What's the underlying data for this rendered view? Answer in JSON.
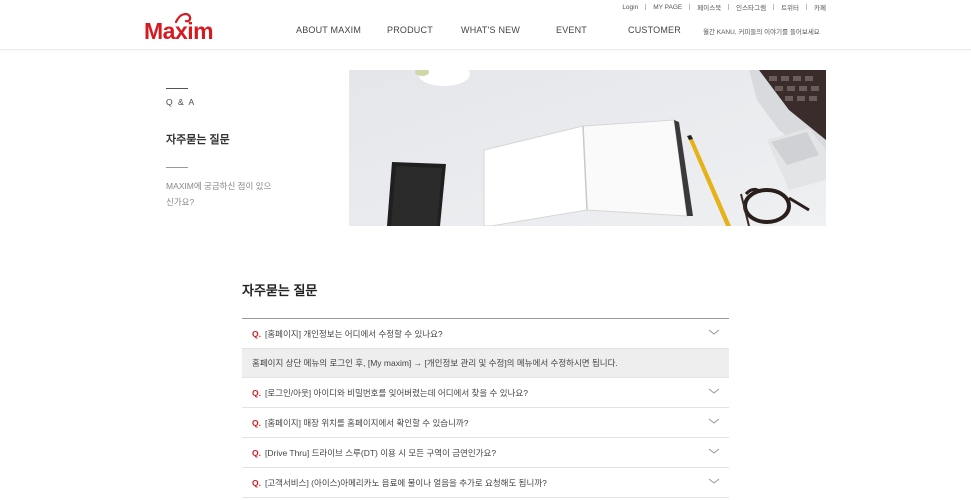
{
  "brand": {
    "logo_text": "Maxim",
    "color": "#d71920"
  },
  "util_links": [
    "Login",
    "MY PAGE",
    "페이스북",
    "인스타그램",
    "트위터",
    "카페"
  ],
  "gnb": {
    "items": [
      "ABOUT MAXIM",
      "PRODUCT",
      "WHAT'S NEW",
      "EVENT",
      "CUSTOMER"
    ],
    "note": "월간 KANU, 커피들의 이야기를 들어보세요"
  },
  "sidebar": {
    "category": "Q & A",
    "title": "자주묻는 질문",
    "description": "MAXIM에 궁금하신 점이 있으신가요?"
  },
  "faq": {
    "heading": "자주묻는 질문",
    "q_prefix": "Q.",
    "items": [
      {
        "question": "[홈페이지] 개인정보는 어디에서 수정할 수 있나요?",
        "expanded": true,
        "answer": "홈페이지 상단 메뉴의 로그인 후, [My maxim] → [개인정보 관리 및 수정]의 메뉴에서 수정하시면 됩니다."
      },
      {
        "question": "[로그인/아웃] 아이디와 비밀번호를 잊어버렸는데 어디에서 찾을 수 있나요?"
      },
      {
        "question": "[홈페이지] 매장 위치를 홈페이지에서 확인할 수 있습니까?"
      },
      {
        "question": "[Drive Thru] 드라이브 스루(DT) 이용 시 모든 구역이 금연인가요?"
      },
      {
        "question": "[고객서비스] (아이스)아메리카노 음료에 물이나 얼음을 추가로 요청해도 됩니까?"
      }
    ]
  },
  "icons": {
    "faq_toggle": "chevron-down-icon"
  }
}
